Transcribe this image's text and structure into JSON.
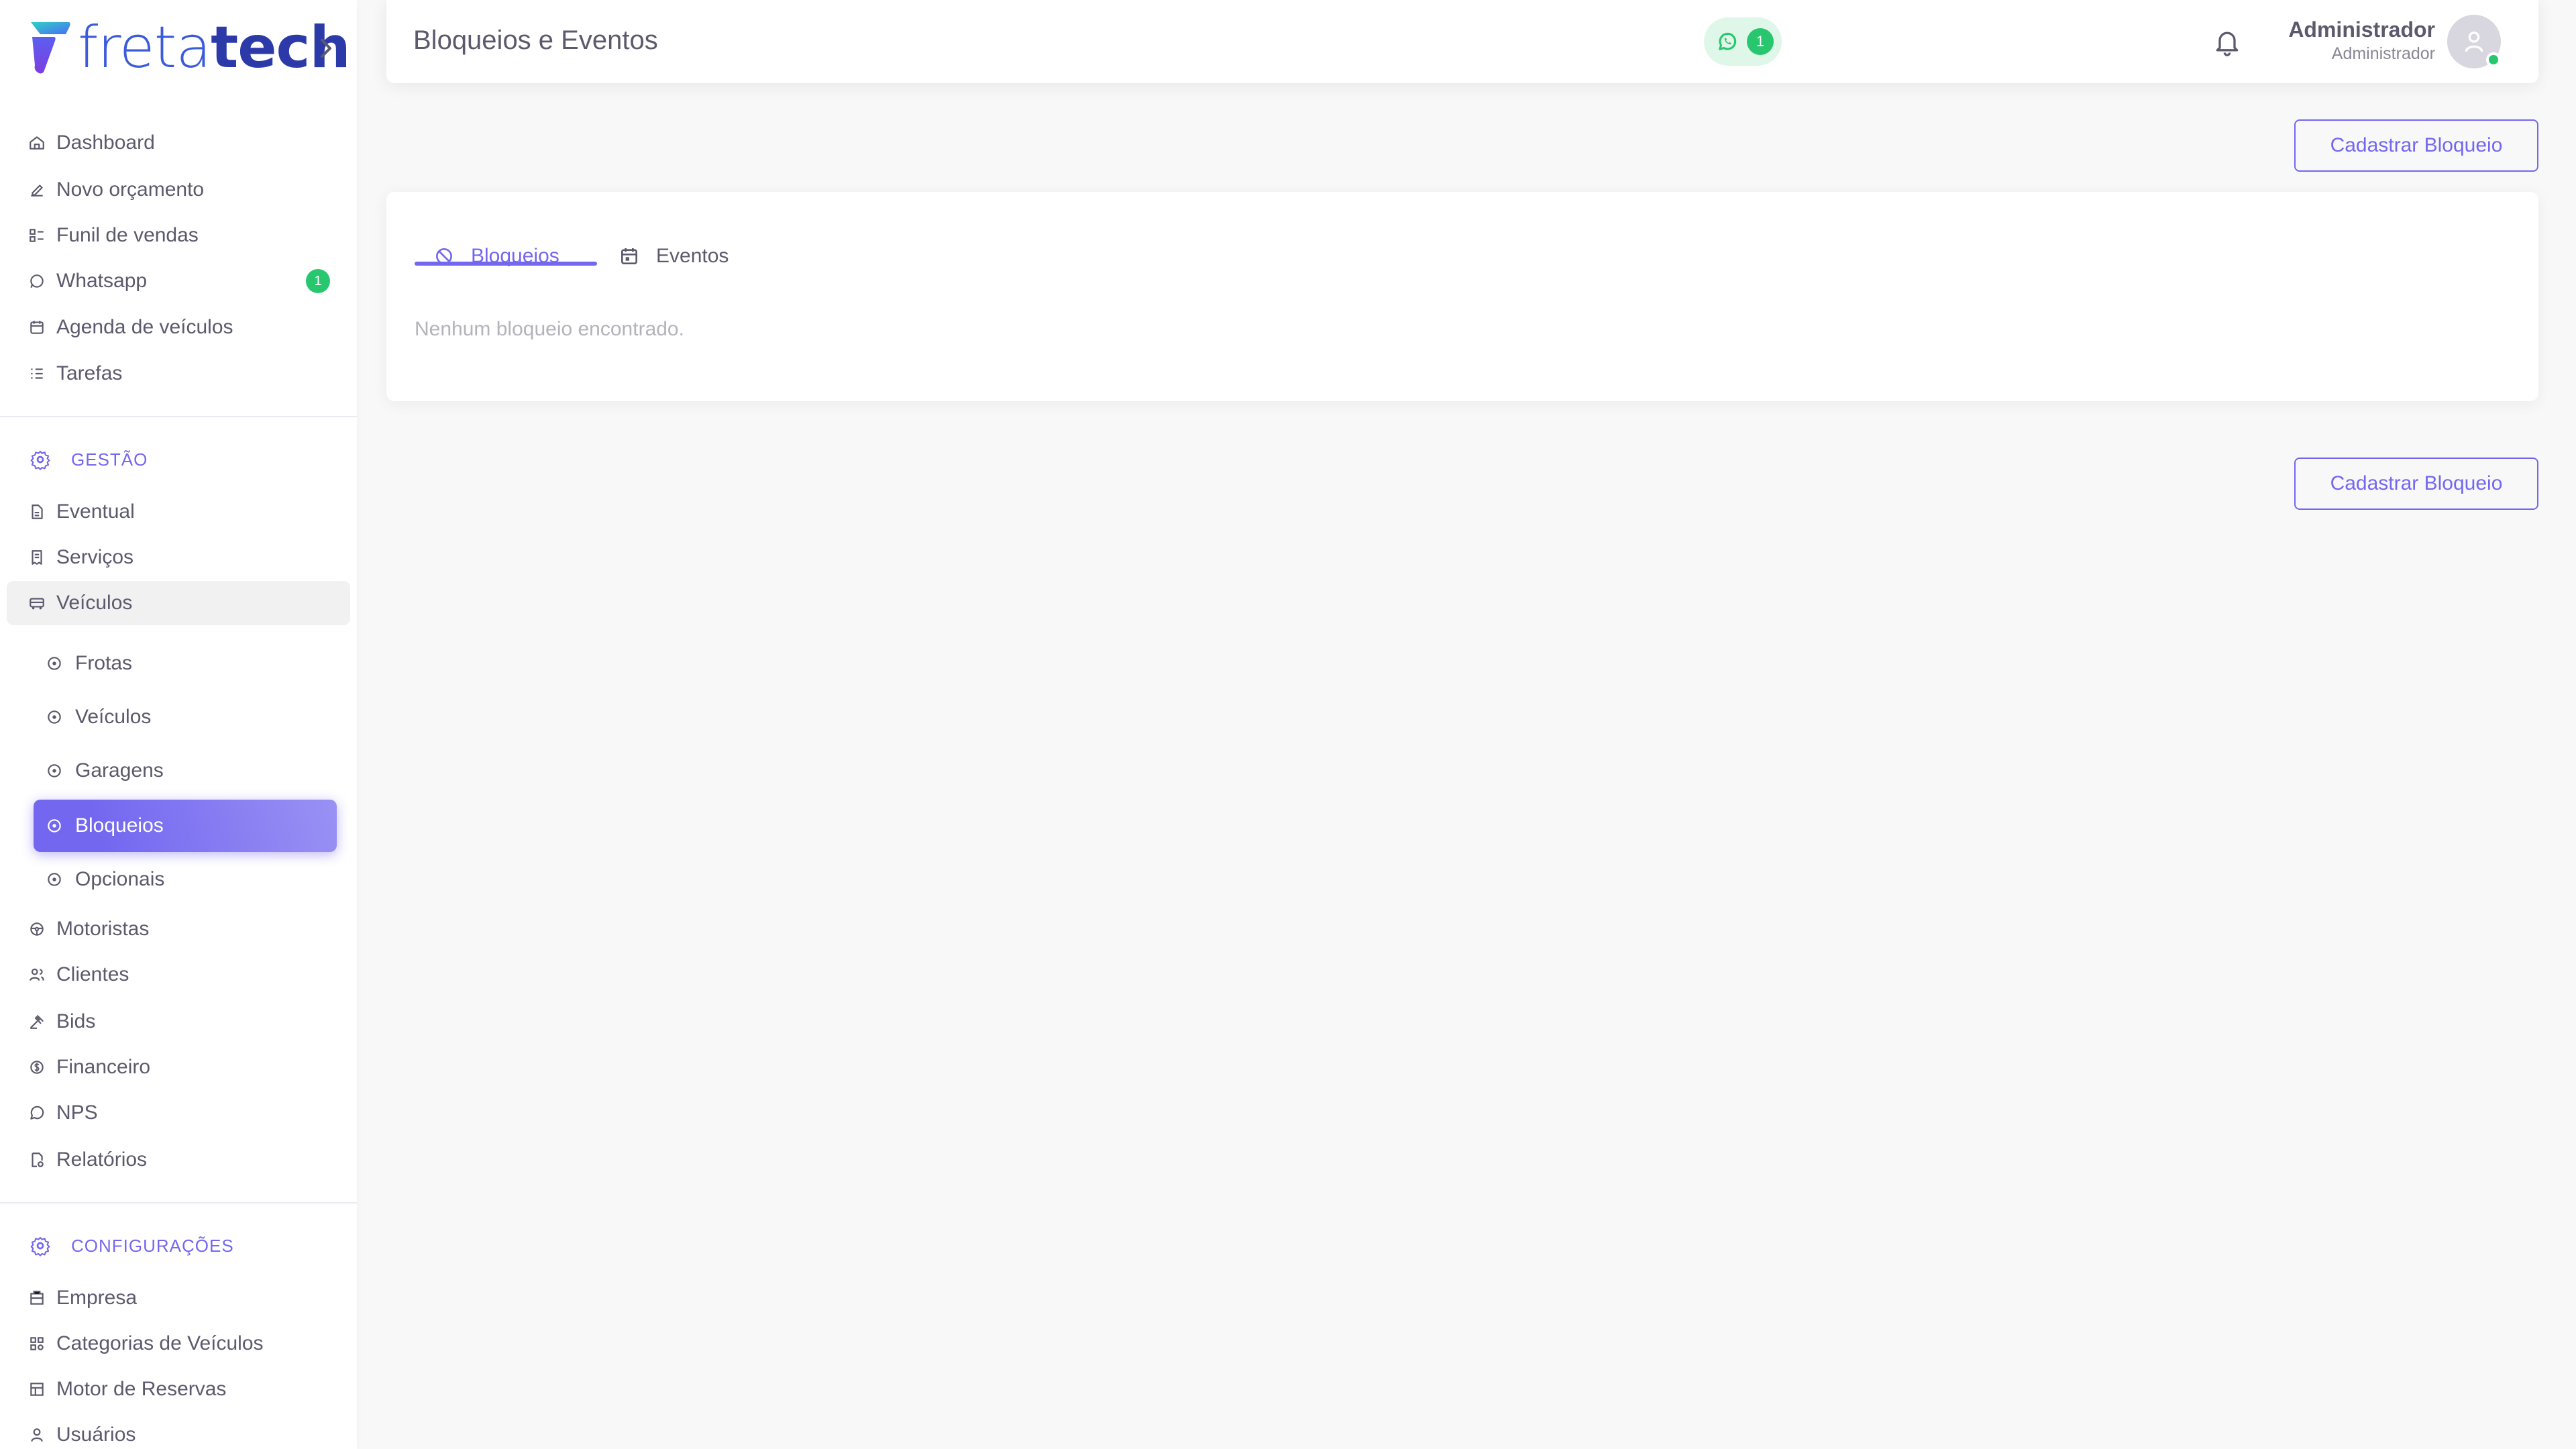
{
  "brand": {
    "part1": "freta",
    "part2": "tech"
  },
  "sidebar": {
    "main_items": [
      {
        "label": "Dashboard"
      },
      {
        "label": "Novo orçamento"
      },
      {
        "label": "Funil de vendas"
      },
      {
        "label": "Whatsapp",
        "badge": "1"
      },
      {
        "label": "Agenda de veículos"
      },
      {
        "label": "Tarefas"
      }
    ],
    "section_gestao": "GESTÃO",
    "gestao_items": [
      {
        "label": "Eventual"
      },
      {
        "label": "Serviços"
      },
      {
        "label": "Veículos"
      }
    ],
    "veiculos_sub": [
      {
        "label": "Frotas"
      },
      {
        "label": "Veículos"
      },
      {
        "label": "Garagens"
      },
      {
        "label": "Bloqueios"
      },
      {
        "label": "Opcionais"
      }
    ],
    "gestao_items_after": [
      {
        "label": "Motoristas"
      },
      {
        "label": "Clientes"
      },
      {
        "label": "Bids"
      },
      {
        "label": "Financeiro"
      },
      {
        "label": "NPS"
      },
      {
        "label": "Relatórios"
      }
    ],
    "section_config": "CONFIGURAÇÕES",
    "config_items": [
      {
        "label": "Empresa"
      },
      {
        "label": "Categorias de Veículos"
      },
      {
        "label": "Motor de Reservas"
      },
      {
        "label": "Usuários"
      }
    ]
  },
  "header": {
    "title": "Bloqueios e Eventos",
    "whatsapp_count": "1",
    "user_name": "Administrador",
    "user_role": "Administrador"
  },
  "content": {
    "add_button": "Cadastrar Bloqueio",
    "tabs": [
      {
        "label": "Bloqueios"
      },
      {
        "label": "Eventos"
      }
    ],
    "empty_message": "Nenhum bloqueio encontrado."
  },
  "colors": {
    "accent": "#7367f0",
    "success": "#28c76f",
    "text": "#5d596c",
    "muted": "#b4b2bb"
  }
}
